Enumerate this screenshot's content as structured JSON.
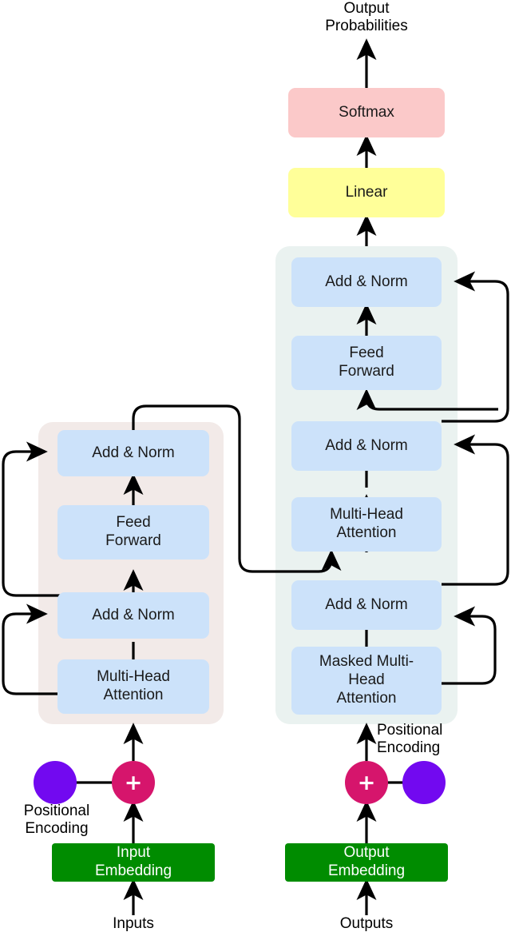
{
  "figure": {
    "title": "Transformer model architecture",
    "type": "diagram",
    "colors": {
      "sublayer_blue": "#cce2fa",
      "softmax_pink": "#fbc9c9",
      "linear_yellow": "#ffff99",
      "embedding_green": "#008c00",
      "embedding_text": "#ffffff",
      "positional_purple": "#7209f0",
      "sum_crimson": "#d6156c",
      "encoder_panel": "#f2eae8",
      "decoder_panel": "#eaf2f0",
      "arrow_black": "#000000",
      "background": "#ffffff"
    }
  },
  "top": {
    "output_probabilities": "Output\nProbabilities",
    "softmax": "Softmax",
    "linear": "Linear"
  },
  "encoder": {
    "panel_name": "encoder-stack",
    "blocks": [
      {
        "label": "Add & Norm"
      },
      {
        "label": "Feed\nForward"
      },
      {
        "label": "Add & Norm"
      },
      {
        "label": "Multi-Head\nAttention"
      }
    ],
    "positional_encoding_label": "Positional\nEncoding",
    "sum_symbol": "+",
    "embedding": "Input\nEmbedding",
    "source": "Inputs"
  },
  "decoder": {
    "panel_name": "decoder-stack",
    "blocks": [
      {
        "label": "Add & Norm"
      },
      {
        "label": "Feed\nForward"
      },
      {
        "label": "Add & Norm"
      },
      {
        "label": "Multi-Head\nAttention"
      },
      {
        "label": "Add & Norm"
      },
      {
        "label": "Masked Multi-\nHead\nAttention"
      }
    ],
    "positional_encoding_label": "Positional\nEncoding",
    "sum_symbol": "+",
    "embedding": "Output\nEmbedding",
    "source": "Outputs"
  }
}
